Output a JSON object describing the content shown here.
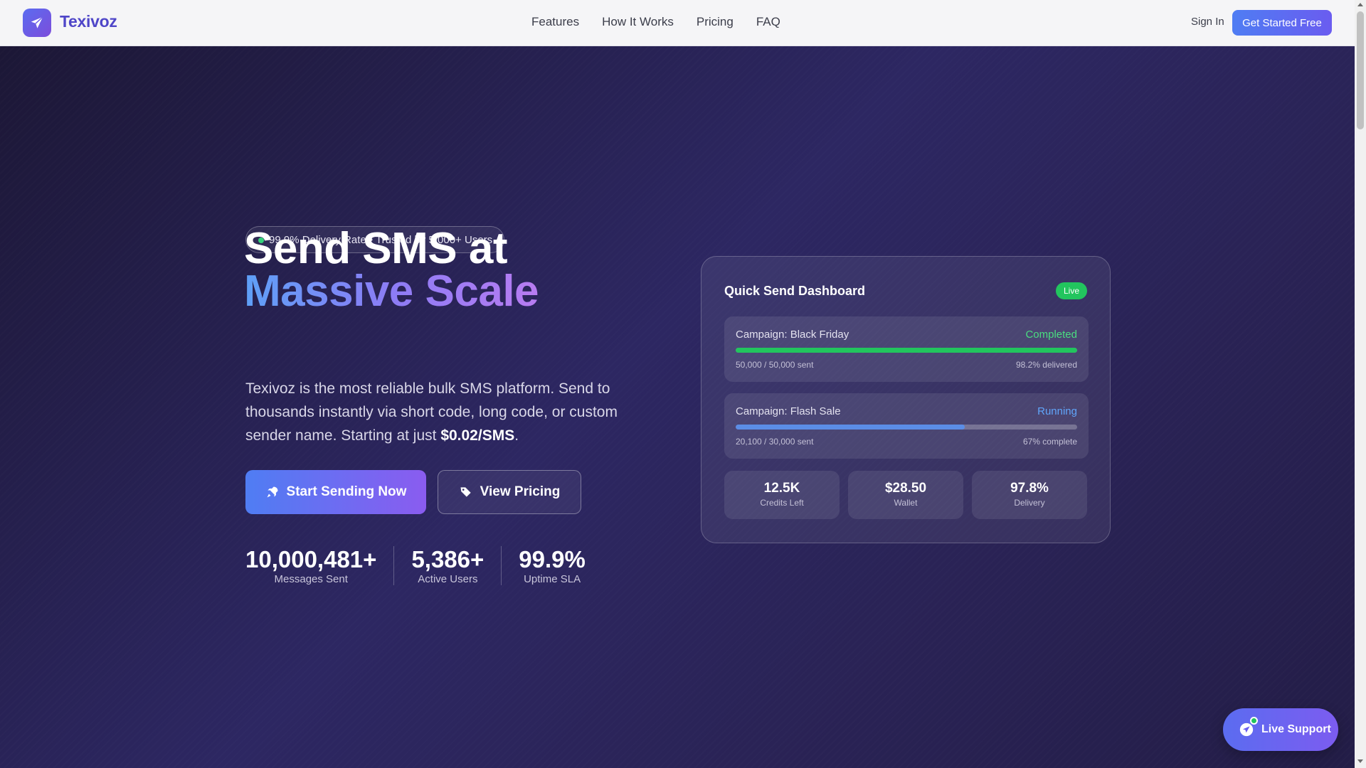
{
  "brand": {
    "name": "Texivoz",
    "logo_icon": "paper-plane-icon"
  },
  "nav": {
    "items": [
      "Features",
      "How It Works",
      "Pricing",
      "FAQ"
    ]
  },
  "header_actions": {
    "sign_in": "Sign In",
    "cta": "Get Started Free"
  },
  "hero": {
    "badge": "99.9% Delivery Rate • Trusted by 5,000+ Users",
    "title_line1": "Send SMS at",
    "title_line2": "Massive Scale",
    "lead_text": "Texivoz is the most reliable bulk SMS platform. Send to thousands instantly via short code, long code, or custom sender name. Starting at just ",
    "lead_price": "$0.02/SMS",
    "lead_end": ".",
    "primary_button": "Start Sending Now",
    "secondary_button": "View Pricing",
    "stats": [
      {
        "value": "10,000,481+",
        "label": "Messages Sent"
      },
      {
        "value": "5,386+",
        "label": "Active Users"
      },
      {
        "value": "99.9%",
        "label": "Uptime SLA"
      }
    ]
  },
  "dashboard": {
    "title": "Quick Send Dashboard",
    "live_label": "Live",
    "campaigns": [
      {
        "name": "Campaign: Black Friday",
        "status": "Completed",
        "status_color": "#4ade80",
        "bar_color": "#22c55e",
        "progress": 1.0,
        "sent": "50,000 / 50,000 sent",
        "detail": "98.2% delivered"
      },
      {
        "name": "Campaign: Flash Sale",
        "status": "Running",
        "status_color": "#60a5fa",
        "bar_color": "#5b8de6",
        "progress": 0.67,
        "sent": "20,100 / 30,000 sent",
        "detail": "67% complete"
      }
    ],
    "metrics": [
      {
        "value": "12.5K",
        "label": "Credits Left"
      },
      {
        "value": "$28.50",
        "label": "Wallet"
      },
      {
        "value": "97.8%",
        "label": "Delivery"
      }
    ]
  },
  "support": {
    "label": "Live Support",
    "icon": "chat-icon"
  },
  "colors": {
    "accent": "#5b6cf0",
    "success": "#22c55e",
    "brand_text": "#4f46c8"
  }
}
